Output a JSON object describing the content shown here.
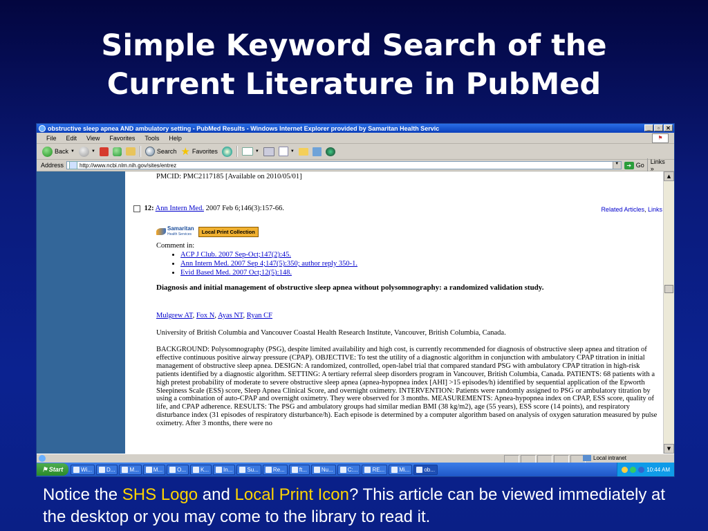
{
  "slide": {
    "title_line1": "Simple Keyword Search of the",
    "title_line2": "Current Literature in PubMed",
    "caption_pre": "Notice the ",
    "caption_hl1": "SHS Logo",
    "caption_mid": " and ",
    "caption_hl2": "Local Print Icon",
    "caption_post": "?  This article can be viewed immediately at the desktop or you may come to the library to read it.",
    "highlight_color": "#ffd400"
  },
  "browser": {
    "title": "obstructive sleep apnea AND ambulatory setting - PubMed Results - Windows Internet Explorer provided by Samaritan Health Servic",
    "window_buttons": [
      "_",
      "▫",
      "✕"
    ],
    "menu": [
      "File",
      "Edit",
      "View",
      "Favorites",
      "Tools",
      "Help"
    ],
    "toolbar": {
      "back": "Back",
      "search": "Search",
      "favorites": "Favorites"
    },
    "address_label": "Address",
    "url": "http://www.ncbi.nlm.nih.gov/sites/entrez",
    "go": "Go",
    "links": "Links",
    "chevron": "»"
  },
  "article": {
    "pmcid": "PMCID: PMC2117185 [Available on 2010/05/01]",
    "number": "12:",
    "journal": "Ann Intern Med.",
    "citation": " 2007 Feb 6;146(3):157-66.",
    "related": "Related Articles",
    "related_sep": ", ",
    "links": "Links",
    "shs_logo_name": "Samaritan",
    "shs_logo_sub": "Health Services",
    "local_print": "Local Print Collection",
    "comment_in": "Comment in:",
    "comments": [
      "ACP J Club. 2007 Sep-Oct;147(2):45.",
      "Ann Intern Med. 2007 Sep 4;147(5):350; author reply 350-1.",
      "Evid Based Med. 2007 Oct;12(5):148."
    ],
    "title": "Diagnosis and initial management of obstructive sleep apnea without polysomnography: a randomized validation study.",
    "authors": [
      "Mulgrew AT",
      "Fox N",
      "Ayas NT",
      "Ryan CF"
    ],
    "author_sep": ", ",
    "affiliation": "University of British Columbia and Vancouver Coastal Health Research Institute, Vancouver, British Columbia, Canada.",
    "abstract": "BACKGROUND: Polysomnography (PSG), despite limited availability and high cost, is currently recommended for diagnosis of obstructive sleep apnea and titration of effective continuous positive airway pressure (CPAP). OBJECTIVE: To test the utility of a diagnostic algorithm in conjunction with ambulatory CPAP titration in initial management of obstructive sleep apnea. DESIGN: A randomized, controlled, open-label trial that compared standard PSG with ambulatory CPAP titration in high-risk patients identified by a diagnostic algorithm. SETTING: A tertiary referral sleep disorders program in Vancouver, British Columbia, Canada. PATIENTS: 68 patients with a high pretest probability of moderate to severe obstructive sleep apnea (apnea-hypopnea index [AHI] >15 episodes/h) identified by sequential application of the Epworth Sleepiness Scale (ESS) score, Sleep Apnea Clinical Score, and overnight oximetry. INTERVENTION: Patients were randomly assigned to PSG or ambulatory titration by using a combination of auto-CPAP and overnight oximetry. They were observed for 3 months. MEASUREMENTS: Apnea-hypopnea index on CPAP, ESS score, quality of life, and CPAP adherence. RESULTS: The PSG and ambulatory groups had similar median BMI (38 kg/m2), age (55 years), ESS score (14 points), and respiratory disturbance index (31 episodes of respiratory disturbance/h). Each episode is determined by a computer algorithm based on analysis of oxygen saturation measured by pulse oximetry. After 3 months, there were no"
  },
  "statusbar": {
    "zone": "Local intranet"
  },
  "taskbar": {
    "start": "Start",
    "buttons": [
      "Wi...",
      "D...",
      "M...",
      "M...",
      "O...",
      "K...",
      "In...",
      "Su...",
      "Re...",
      "ft...",
      "Nu...",
      "C:...",
      "RE...",
      "Mi...",
      "ob..."
    ],
    "active_index": 14,
    "clock": "10:44 AM"
  }
}
